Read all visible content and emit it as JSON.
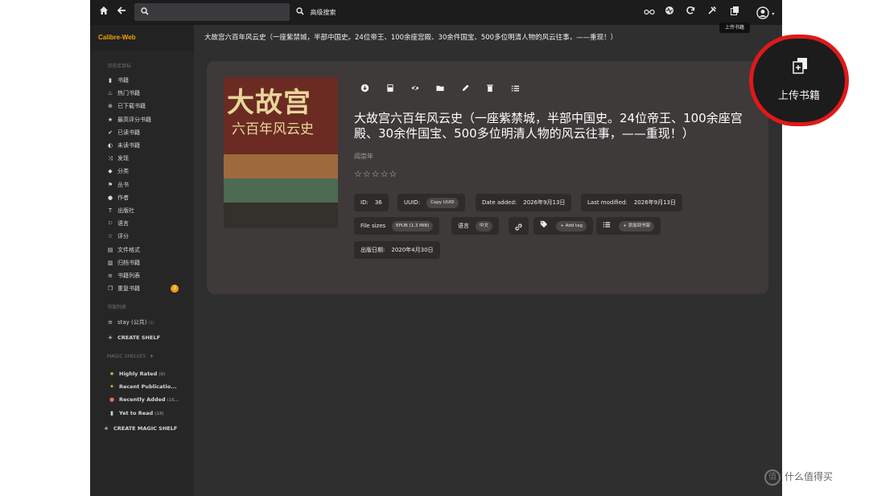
{
  "header": {
    "search_placeholder": "",
    "advanced_search": "高级搜索",
    "icons": [
      "home-icon",
      "back-icon",
      "search-icon",
      "eye-glasses-icon",
      "activity-icon",
      "refresh-icon",
      "tools-icon",
      "upload-icon",
      "user-icon"
    ]
  },
  "sidebar": {
    "brand": "Calibre-Web",
    "browse_title": "浏览库目标",
    "items": [
      {
        "label": "书籍",
        "icon": "book-icon"
      },
      {
        "label": "热门书籍",
        "icon": "fire-icon"
      },
      {
        "label": "已下载书籍",
        "icon": "download-icon"
      },
      {
        "label": "最高评分书籍",
        "icon": "star-icon"
      },
      {
        "label": "已读书籍",
        "icon": "check-icon"
      },
      {
        "label": "未读书籍",
        "icon": "eye-slash-icon"
      },
      {
        "label": "发现",
        "icon": "random-icon"
      },
      {
        "label": "分类",
        "icon": "tags-icon"
      },
      {
        "label": "丛书",
        "icon": "bookmark-icon"
      },
      {
        "label": "作者",
        "icon": "user-icon"
      },
      {
        "label": "出版社",
        "icon": "text-size-icon"
      },
      {
        "label": "语言",
        "icon": "flag-icon"
      },
      {
        "label": "评分",
        "icon": "star-empty-icon"
      },
      {
        "label": "文件格式",
        "icon": "file-icon"
      },
      {
        "label": "归档书籍",
        "icon": "trash-icon"
      },
      {
        "label": "书籍列表",
        "icon": "list-icon"
      },
      {
        "label": "重复书籍",
        "icon": "duplicate-icon",
        "badge": "3"
      }
    ],
    "shelves_title": "书架列表",
    "shelves": [
      {
        "label": "stay (公共)",
        "count": "(1)"
      }
    ],
    "create_shelf": "CREATE SHELF",
    "magic_title": "MAGIC SHELVES",
    "magic_plus": "+",
    "magic_shelves": [
      {
        "label": "Highly Rated",
        "count": "(0)",
        "icon": "star-icon",
        "color": "#f1c232"
      },
      {
        "label": "Recent Publicatio...",
        "count": "",
        "icon": "sparkle-icon",
        "color": "#f1c232"
      },
      {
        "label": "Recently Added",
        "count": "(16...",
        "icon": "bear-icon",
        "color": "#e07060"
      },
      {
        "label": "Yet to Read",
        "count": "(18)",
        "icon": "book-icon",
        "color": "#cfcfcf"
      }
    ],
    "create_magic_shelf": "CREATE MAGIC SHELF"
  },
  "page_title": "大故宫六百年风云史（一座紫禁城，半部中国史。24位帝王、100余座宫殿、30余件国宝、500多位明清人物的风云往事，——重现！）",
  "book": {
    "cover_title": "大故宫",
    "cover_subtitle": "六百年风云史",
    "title": "大故宫六百年风云史（一座紫禁城，半部中国史。24位帝王、100余座宫殿、30余件国宝、500多位明清人物的风云往事，——重现！）",
    "author": "阎崇年",
    "rating": 0,
    "rating_max": 5,
    "stars_text": "☆☆☆☆☆",
    "actions": [
      "download-icon",
      "read-icon",
      "hide-icon",
      "folder-icon",
      "edit-icon",
      "delete-icon",
      "list-icon"
    ],
    "id_label": "ID:",
    "id_value": "36",
    "uuid_label": "UUID:",
    "uuid_button": "Copy UUID",
    "date_added_label": "Date added:",
    "date_added_value": "2026年9月13日",
    "last_modified_label": "Last modified:",
    "last_modified_value": "2026年9月13日",
    "file_sizes_label": "File sizes",
    "file_sizes_value": "EPUB (1.3 MiB)",
    "language_label": "语言",
    "language_value": "中文",
    "add_tag": "+ Add tag",
    "add_shelf": "+ 添加到书架",
    "pubdate_label": "出版日期:",
    "pubdate_value": "2020年4月30日"
  },
  "tooltip": "上传书籍",
  "callout_label": "上传书籍",
  "watermark": "什么值得买",
  "watermark_logo": "值"
}
